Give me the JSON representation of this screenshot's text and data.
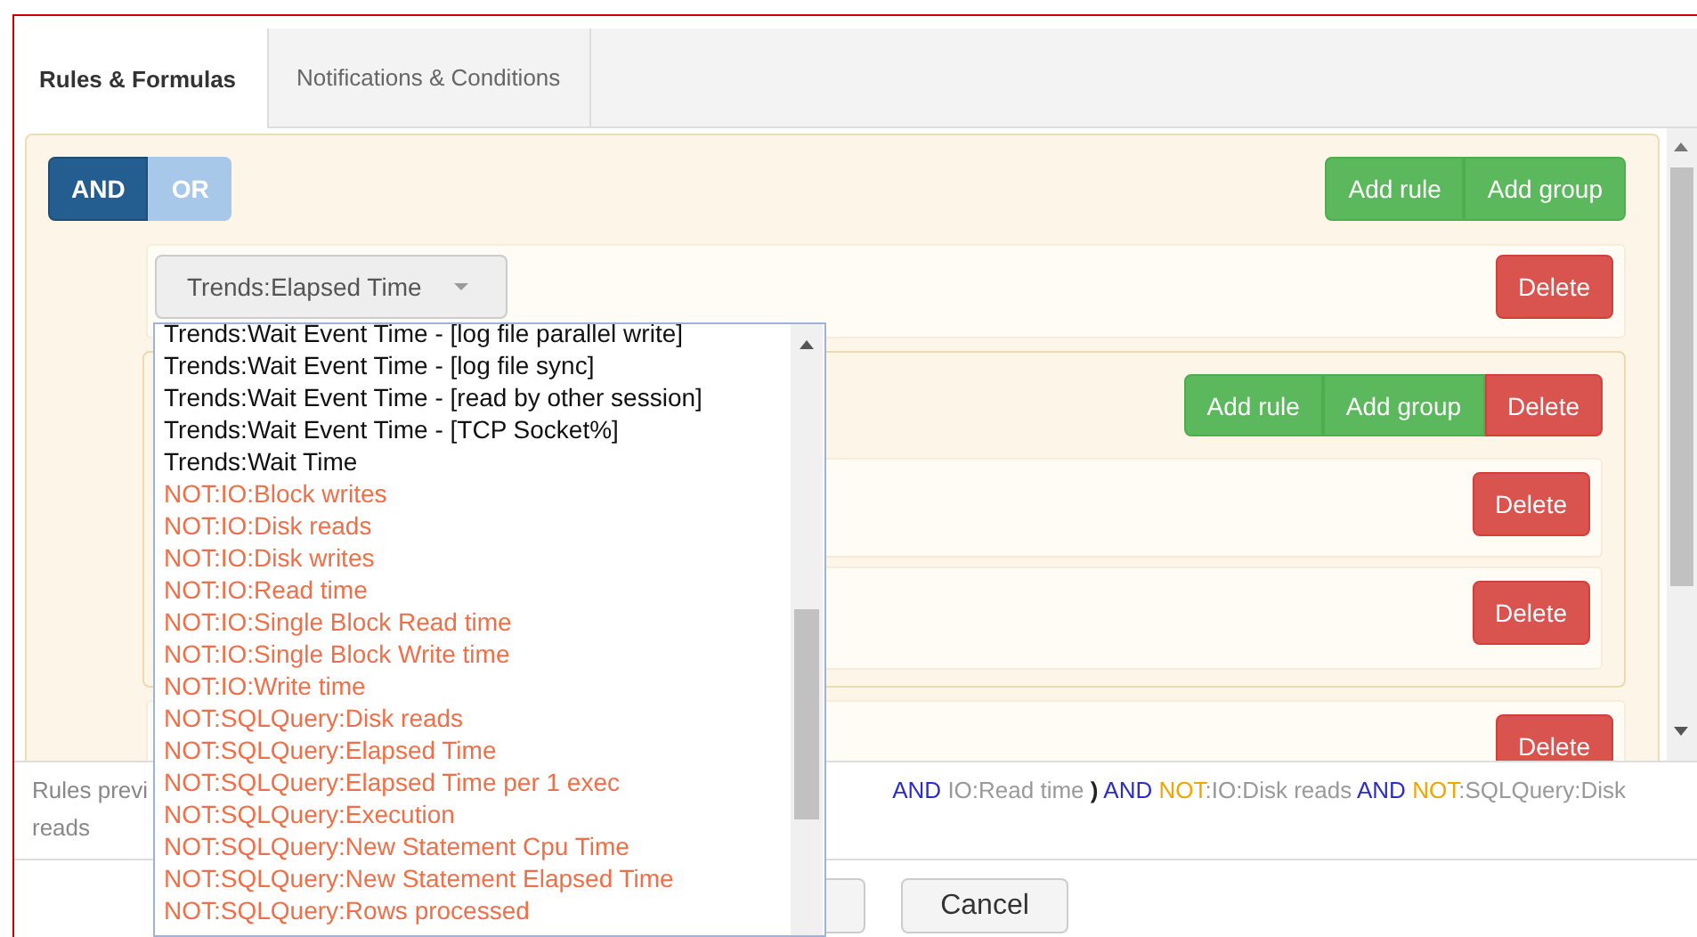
{
  "tabs": [
    {
      "label": "Rules & Formulas",
      "selected": true
    },
    {
      "label": "Notifications & Conditions",
      "selected": false
    }
  ],
  "builder": {
    "conjunctions": [
      {
        "label": "AND",
        "selected": true
      },
      {
        "label": "OR",
        "selected": false
      }
    ],
    "actions": [
      {
        "label": "Add rule",
        "kind": "add"
      },
      {
        "label": "Add group",
        "kind": "add"
      }
    ],
    "rules": [
      {
        "kind": "rule",
        "field": "Trends:Elapsed Time",
        "actions": [
          {
            "label": "Delete",
            "kind": "delete"
          }
        ]
      },
      {
        "kind": "group",
        "actions": [
          {
            "label": "Add rule",
            "kind": "add"
          },
          {
            "label": "Add group",
            "kind": "add"
          },
          {
            "label": "Delete",
            "kind": "delete"
          }
        ],
        "rules": [
          {
            "kind": "rule",
            "actions": [
              {
                "label": "Delete",
                "kind": "delete"
              }
            ]
          },
          {
            "kind": "rule",
            "actions": [
              {
                "label": "Delete",
                "kind": "delete"
              }
            ]
          }
        ]
      },
      {
        "kind": "rule",
        "actions": [
          {
            "label": "Delete",
            "kind": "delete"
          }
        ]
      }
    ]
  },
  "dropdown": {
    "items": [
      {
        "label": "Trends:Wait Event Time - [log file parallel write]",
        "negated": false
      },
      {
        "label": "Trends:Wait Event Time - [log file sync]",
        "negated": false
      },
      {
        "label": "Trends:Wait Event Time - [read by other session]",
        "negated": false
      },
      {
        "label": "Trends:Wait Event Time - [TCP Socket%]",
        "negated": false
      },
      {
        "label": "Trends:Wait Time",
        "negated": false
      },
      {
        "label": "NOT:IO:Block writes",
        "negated": true
      },
      {
        "label": "NOT:IO:Disk reads",
        "negated": true
      },
      {
        "label": "NOT:IO:Disk writes",
        "negated": true
      },
      {
        "label": "NOT:IO:Read time",
        "negated": true
      },
      {
        "label": "NOT:IO:Single Block Read time",
        "negated": true
      },
      {
        "label": "NOT:IO:Single Block Write time",
        "negated": true
      },
      {
        "label": "NOT:IO:Write time",
        "negated": true
      },
      {
        "label": "NOT:SQLQuery:Disk reads",
        "negated": true
      },
      {
        "label": "NOT:SQLQuery:Elapsed Time",
        "negated": true
      },
      {
        "label": "NOT:SQLQuery:Elapsed Time per 1 exec",
        "negated": true
      },
      {
        "label": "NOT:SQLQuery:Execution",
        "negated": true
      },
      {
        "label": "NOT:SQLQuery:New Statement Cpu Time",
        "negated": true
      },
      {
        "label": "NOT:SQLQuery:New Statement Elapsed Time",
        "negated": true
      },
      {
        "label": "NOT:SQLQuery:Rows processed",
        "negated": true
      }
    ]
  },
  "preview": {
    "label": "Rules previ",
    "tokens": [
      {
        "kind": "operator",
        "text": "AND"
      },
      {
        "kind": "field",
        "text": "IO:Read time"
      },
      {
        "kind": "paren",
        "text": ")"
      },
      {
        "kind": "operator",
        "text": "AND"
      },
      {
        "kind": "negation",
        "text": "NOT"
      },
      {
        "kind": "field",
        "text": ":IO:Disk reads"
      },
      {
        "kind": "operator",
        "text": "AND"
      },
      {
        "kind": "negation",
        "text": "NOT"
      },
      {
        "kind": "field",
        "text": ":SQLQuery:Disk"
      }
    ],
    "continuation": "reads"
  },
  "buttons": [
    {
      "label": "Cancel"
    }
  ]
}
